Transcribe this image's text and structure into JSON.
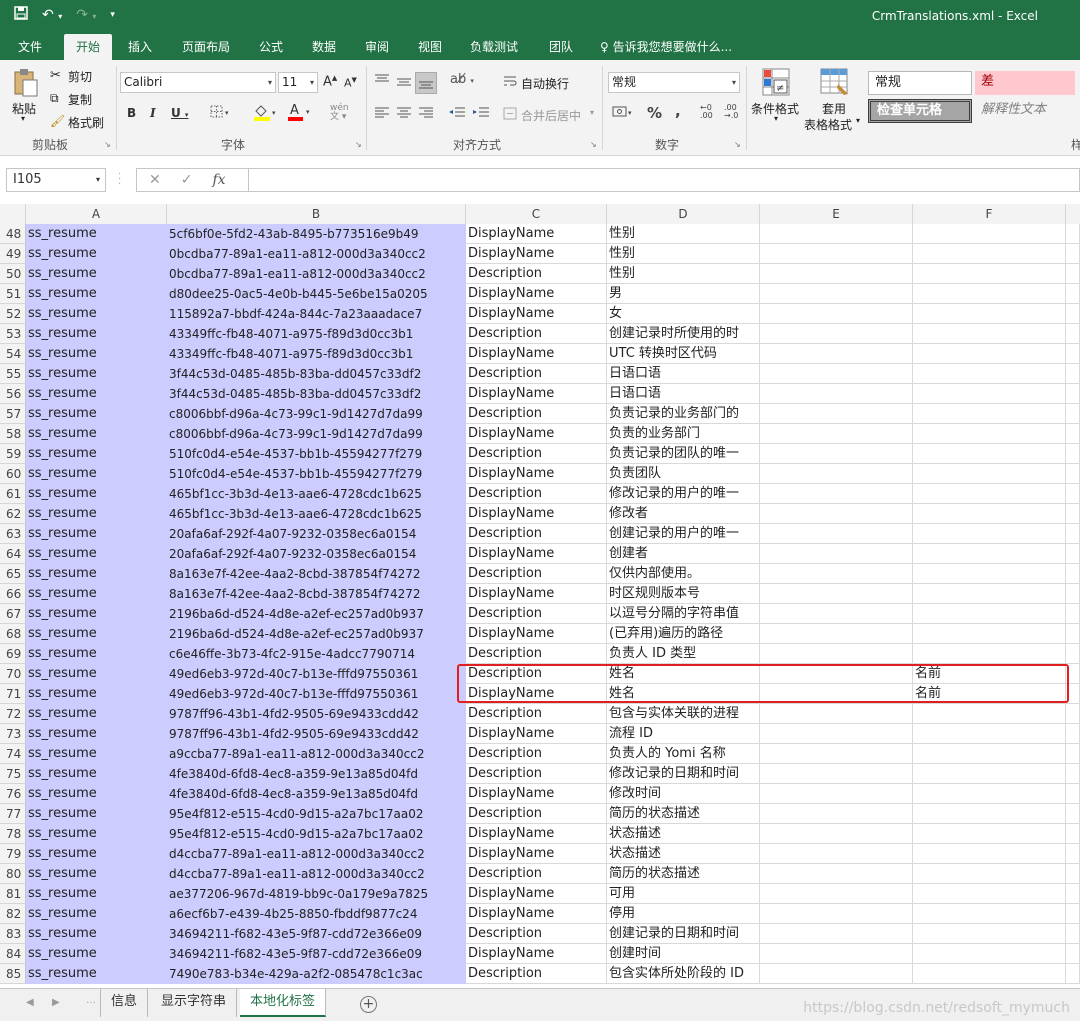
{
  "window": {
    "title": "CrmTranslations.xml - Excel"
  },
  "ribbon_tabs": [
    "文件",
    "开始",
    "插入",
    "页面布局",
    "公式",
    "数据",
    "审阅",
    "视图",
    "负载测试",
    "团队",
    "♀ 告诉我您想要做什么..."
  ],
  "ribbon": {
    "paste": "粘贴",
    "cut": "剪切",
    "copy": "复制",
    "format_painter": "格式刷",
    "clipboard_label": "剪贴板",
    "font_name": "Calibri",
    "font_size": "11",
    "font_label": "字体",
    "wrap_text": "自动换行",
    "merge_center": "合并后居中",
    "align_label": "对齐方式",
    "number_format": "常规",
    "number_label": "数字",
    "cond_format": "条件格式",
    "format_table_1": "套用",
    "format_table_2": "表格格式",
    "style_normal": "常规",
    "style_bad": "差",
    "style_check": "检查单元格",
    "style_explain": "解释性文本",
    "styles_label_partial": "样"
  },
  "formula_bar": {
    "name_box": "I105",
    "fx": "fx",
    "value": ""
  },
  "columns": [
    "A",
    "B",
    "C",
    "D",
    "E",
    "F"
  ],
  "rows": [
    {
      "n": "48",
      "a": "ss_resume",
      "b": "5cf6bf0e-5fd2-43ab-8495-b773516e9b49",
      "c": "DisplayName",
      "d": "性别",
      "e": "",
      "f": ""
    },
    {
      "n": "49",
      "a": "ss_resume",
      "b": "0bcdba77-89a1-ea11-a812-000d3a340cc2",
      "c": "DisplayName",
      "d": "性别",
      "e": "",
      "f": ""
    },
    {
      "n": "50",
      "a": "ss_resume",
      "b": "0bcdba77-89a1-ea11-a812-000d3a340cc2",
      "c": "Description",
      "d": "性别",
      "e": "",
      "f": ""
    },
    {
      "n": "51",
      "a": "ss_resume",
      "b": "d80dee25-0ac5-4e0b-b445-5e6be15a0205",
      "c": "DisplayName",
      "d": "男",
      "e": "",
      "f": ""
    },
    {
      "n": "52",
      "a": "ss_resume",
      "b": "115892a7-bbdf-424a-844c-7a23aaadace7",
      "c": "DisplayName",
      "d": "女",
      "e": "",
      "f": ""
    },
    {
      "n": "53",
      "a": "ss_resume",
      "b": "43349ffc-fb48-4071-a975-f89d3d0cc3b1",
      "c": "Description",
      "d": "创建记录时所使用的时",
      "e": "",
      "f": ""
    },
    {
      "n": "54",
      "a": "ss_resume",
      "b": "43349ffc-fb48-4071-a975-f89d3d0cc3b1",
      "c": "DisplayName",
      "d": "UTC 转换时区代码",
      "e": "",
      "f": ""
    },
    {
      "n": "55",
      "a": "ss_resume",
      "b": "3f44c53d-0485-485b-83ba-dd0457c33df2",
      "c": "Description",
      "d": "日语口语",
      "e": "",
      "f": ""
    },
    {
      "n": "56",
      "a": "ss_resume",
      "b": "3f44c53d-0485-485b-83ba-dd0457c33df2",
      "c": "DisplayName",
      "d": "日语口语",
      "e": "",
      "f": ""
    },
    {
      "n": "57",
      "a": "ss_resume",
      "b": "c8006bbf-d96a-4c73-99c1-9d1427d7da99",
      "c": "Description",
      "d": "负责记录的业务部门的",
      "e": "",
      "f": ""
    },
    {
      "n": "58",
      "a": "ss_resume",
      "b": "c8006bbf-d96a-4c73-99c1-9d1427d7da99",
      "c": "DisplayName",
      "d": "负责的业务部门",
      "e": "",
      "f": ""
    },
    {
      "n": "59",
      "a": "ss_resume",
      "b": "510fc0d4-e54e-4537-bb1b-45594277f279",
      "c": "Description",
      "d": "负责记录的团队的唯一",
      "e": "",
      "f": ""
    },
    {
      "n": "60",
      "a": "ss_resume",
      "b": "510fc0d4-e54e-4537-bb1b-45594277f279",
      "c": "DisplayName",
      "d": "负责团队",
      "e": "",
      "f": ""
    },
    {
      "n": "61",
      "a": "ss_resume",
      "b": "465bf1cc-3b3d-4e13-aae6-4728cdc1b625",
      "c": "Description",
      "d": "修改记录的用户的唯一",
      "e": "",
      "f": ""
    },
    {
      "n": "62",
      "a": "ss_resume",
      "b": "465bf1cc-3b3d-4e13-aae6-4728cdc1b625",
      "c": "DisplayName",
      "d": "修改者",
      "e": "",
      "f": ""
    },
    {
      "n": "63",
      "a": "ss_resume",
      "b": "20afa6af-292f-4a07-9232-0358ec6a0154",
      "c": "Description",
      "d": "创建记录的用户的唯一",
      "e": "",
      "f": ""
    },
    {
      "n": "64",
      "a": "ss_resume",
      "b": "20afa6af-292f-4a07-9232-0358ec6a0154",
      "c": "DisplayName",
      "d": "创建者",
      "e": "",
      "f": ""
    },
    {
      "n": "65",
      "a": "ss_resume",
      "b": "8a163e7f-42ee-4aa2-8cbd-387854f74272",
      "c": "Description",
      "d": "仅供内部使用。",
      "e": "",
      "f": ""
    },
    {
      "n": "66",
      "a": "ss_resume",
      "b": "8a163e7f-42ee-4aa2-8cbd-387854f74272",
      "c": "DisplayName",
      "d": "时区规则版本号",
      "e": "",
      "f": ""
    },
    {
      "n": "67",
      "a": "ss_resume",
      "b": "2196ba6d-d524-4d8e-a2ef-ec257ad0b937",
      "c": "Description",
      "d": "以逗号分隔的字符串值",
      "e": "",
      "f": ""
    },
    {
      "n": "68",
      "a": "ss_resume",
      "b": "2196ba6d-d524-4d8e-a2ef-ec257ad0b937",
      "c": "DisplayName",
      "d": "(已弃用)遍历的路径",
      "e": "",
      "f": ""
    },
    {
      "n": "69",
      "a": "ss_resume",
      "b": "c6e46ffe-3b73-4fc2-915e-4adcc7790714",
      "c": "Description",
      "d": "负责人 ID 类型",
      "e": "",
      "f": ""
    },
    {
      "n": "70",
      "a": "ss_resume",
      "b": "49ed6eb3-972d-40c7-b13e-fffd97550361",
      "c": "Description",
      "d": "姓名",
      "e": "",
      "f": "名前"
    },
    {
      "n": "71",
      "a": "ss_resume",
      "b": "49ed6eb3-972d-40c7-b13e-fffd97550361",
      "c": "DisplayName",
      "d": "姓名",
      "e": "",
      "f": "名前"
    },
    {
      "n": "72",
      "a": "ss_resume",
      "b": "9787ff96-43b1-4fd2-9505-69e9433cdd42",
      "c": "Description",
      "d": "包含与实体关联的进程",
      "e": "",
      "f": ""
    },
    {
      "n": "73",
      "a": "ss_resume",
      "b": "9787ff96-43b1-4fd2-9505-69e9433cdd42",
      "c": "DisplayName",
      "d": "流程 ID",
      "e": "",
      "f": ""
    },
    {
      "n": "74",
      "a": "ss_resume",
      "b": "a9ccba77-89a1-ea11-a812-000d3a340cc2",
      "c": "Description",
      "d": "负责人的 Yomi 名称",
      "e": "",
      "f": ""
    },
    {
      "n": "75",
      "a": "ss_resume",
      "b": "4fe3840d-6fd8-4ec8-a359-9e13a85d04fd",
      "c": "Description",
      "d": "修改记录的日期和时间",
      "e": "",
      "f": ""
    },
    {
      "n": "76",
      "a": "ss_resume",
      "b": "4fe3840d-6fd8-4ec8-a359-9e13a85d04fd",
      "c": "DisplayName",
      "d": "修改时间",
      "e": "",
      "f": ""
    },
    {
      "n": "77",
      "a": "ss_resume",
      "b": "95e4f812-e515-4cd0-9d15-a2a7bc17aa02",
      "c": "Description",
      "d": "简历的状态描述",
      "e": "",
      "f": ""
    },
    {
      "n": "78",
      "a": "ss_resume",
      "b": "95e4f812-e515-4cd0-9d15-a2a7bc17aa02",
      "c": "DisplayName",
      "d": "状态描述",
      "e": "",
      "f": ""
    },
    {
      "n": "79",
      "a": "ss_resume",
      "b": "d4ccba77-89a1-ea11-a812-000d3a340cc2",
      "c": "DisplayName",
      "d": "状态描述",
      "e": "",
      "f": ""
    },
    {
      "n": "80",
      "a": "ss_resume",
      "b": "d4ccba77-89a1-ea11-a812-000d3a340cc2",
      "c": "Description",
      "d": "简历的状态描述",
      "e": "",
      "f": ""
    },
    {
      "n": "81",
      "a": "ss_resume",
      "b": "ae377206-967d-4819-bb9c-0a179e9a7825",
      "c": "DisplayName",
      "d": "可用",
      "e": "",
      "f": ""
    },
    {
      "n": "82",
      "a": "ss_resume",
      "b": "a6ecf6b7-e439-4b25-8850-fbddf9877c24",
      "c": "DisplayName",
      "d": "停用",
      "e": "",
      "f": ""
    },
    {
      "n": "83",
      "a": "ss_resume",
      "b": "34694211-f682-43e5-9f87-cdd72e366e09",
      "c": "Description",
      "d": "创建记录的日期和时间",
      "e": "",
      "f": ""
    },
    {
      "n": "84",
      "a": "ss_resume",
      "b": "34694211-f682-43e5-9f87-cdd72e366e09",
      "c": "DisplayName",
      "d": "创建时间",
      "e": "",
      "f": ""
    },
    {
      "n": "85",
      "a": "ss_resume",
      "b": "7490e783-b34e-429a-a2f2-085478c1c3ac",
      "c": "Description",
      "d": "包含实体所处阶段的 ID",
      "e": "",
      "f": ""
    }
  ],
  "sheets": [
    {
      "label": "信息",
      "active": false
    },
    {
      "label": "显示字符串",
      "active": false
    },
    {
      "label": "本地化标签",
      "active": true
    }
  ],
  "watermark": "https://blog.csdn.net/redsoft_mymuch",
  "colors": {
    "excel_green": "#217346",
    "highlight_lavender": "#ccccff",
    "red_box": "#e02020",
    "style_bad_bg": "#ffc7ce",
    "style_bad_fg": "#9c0006"
  }
}
